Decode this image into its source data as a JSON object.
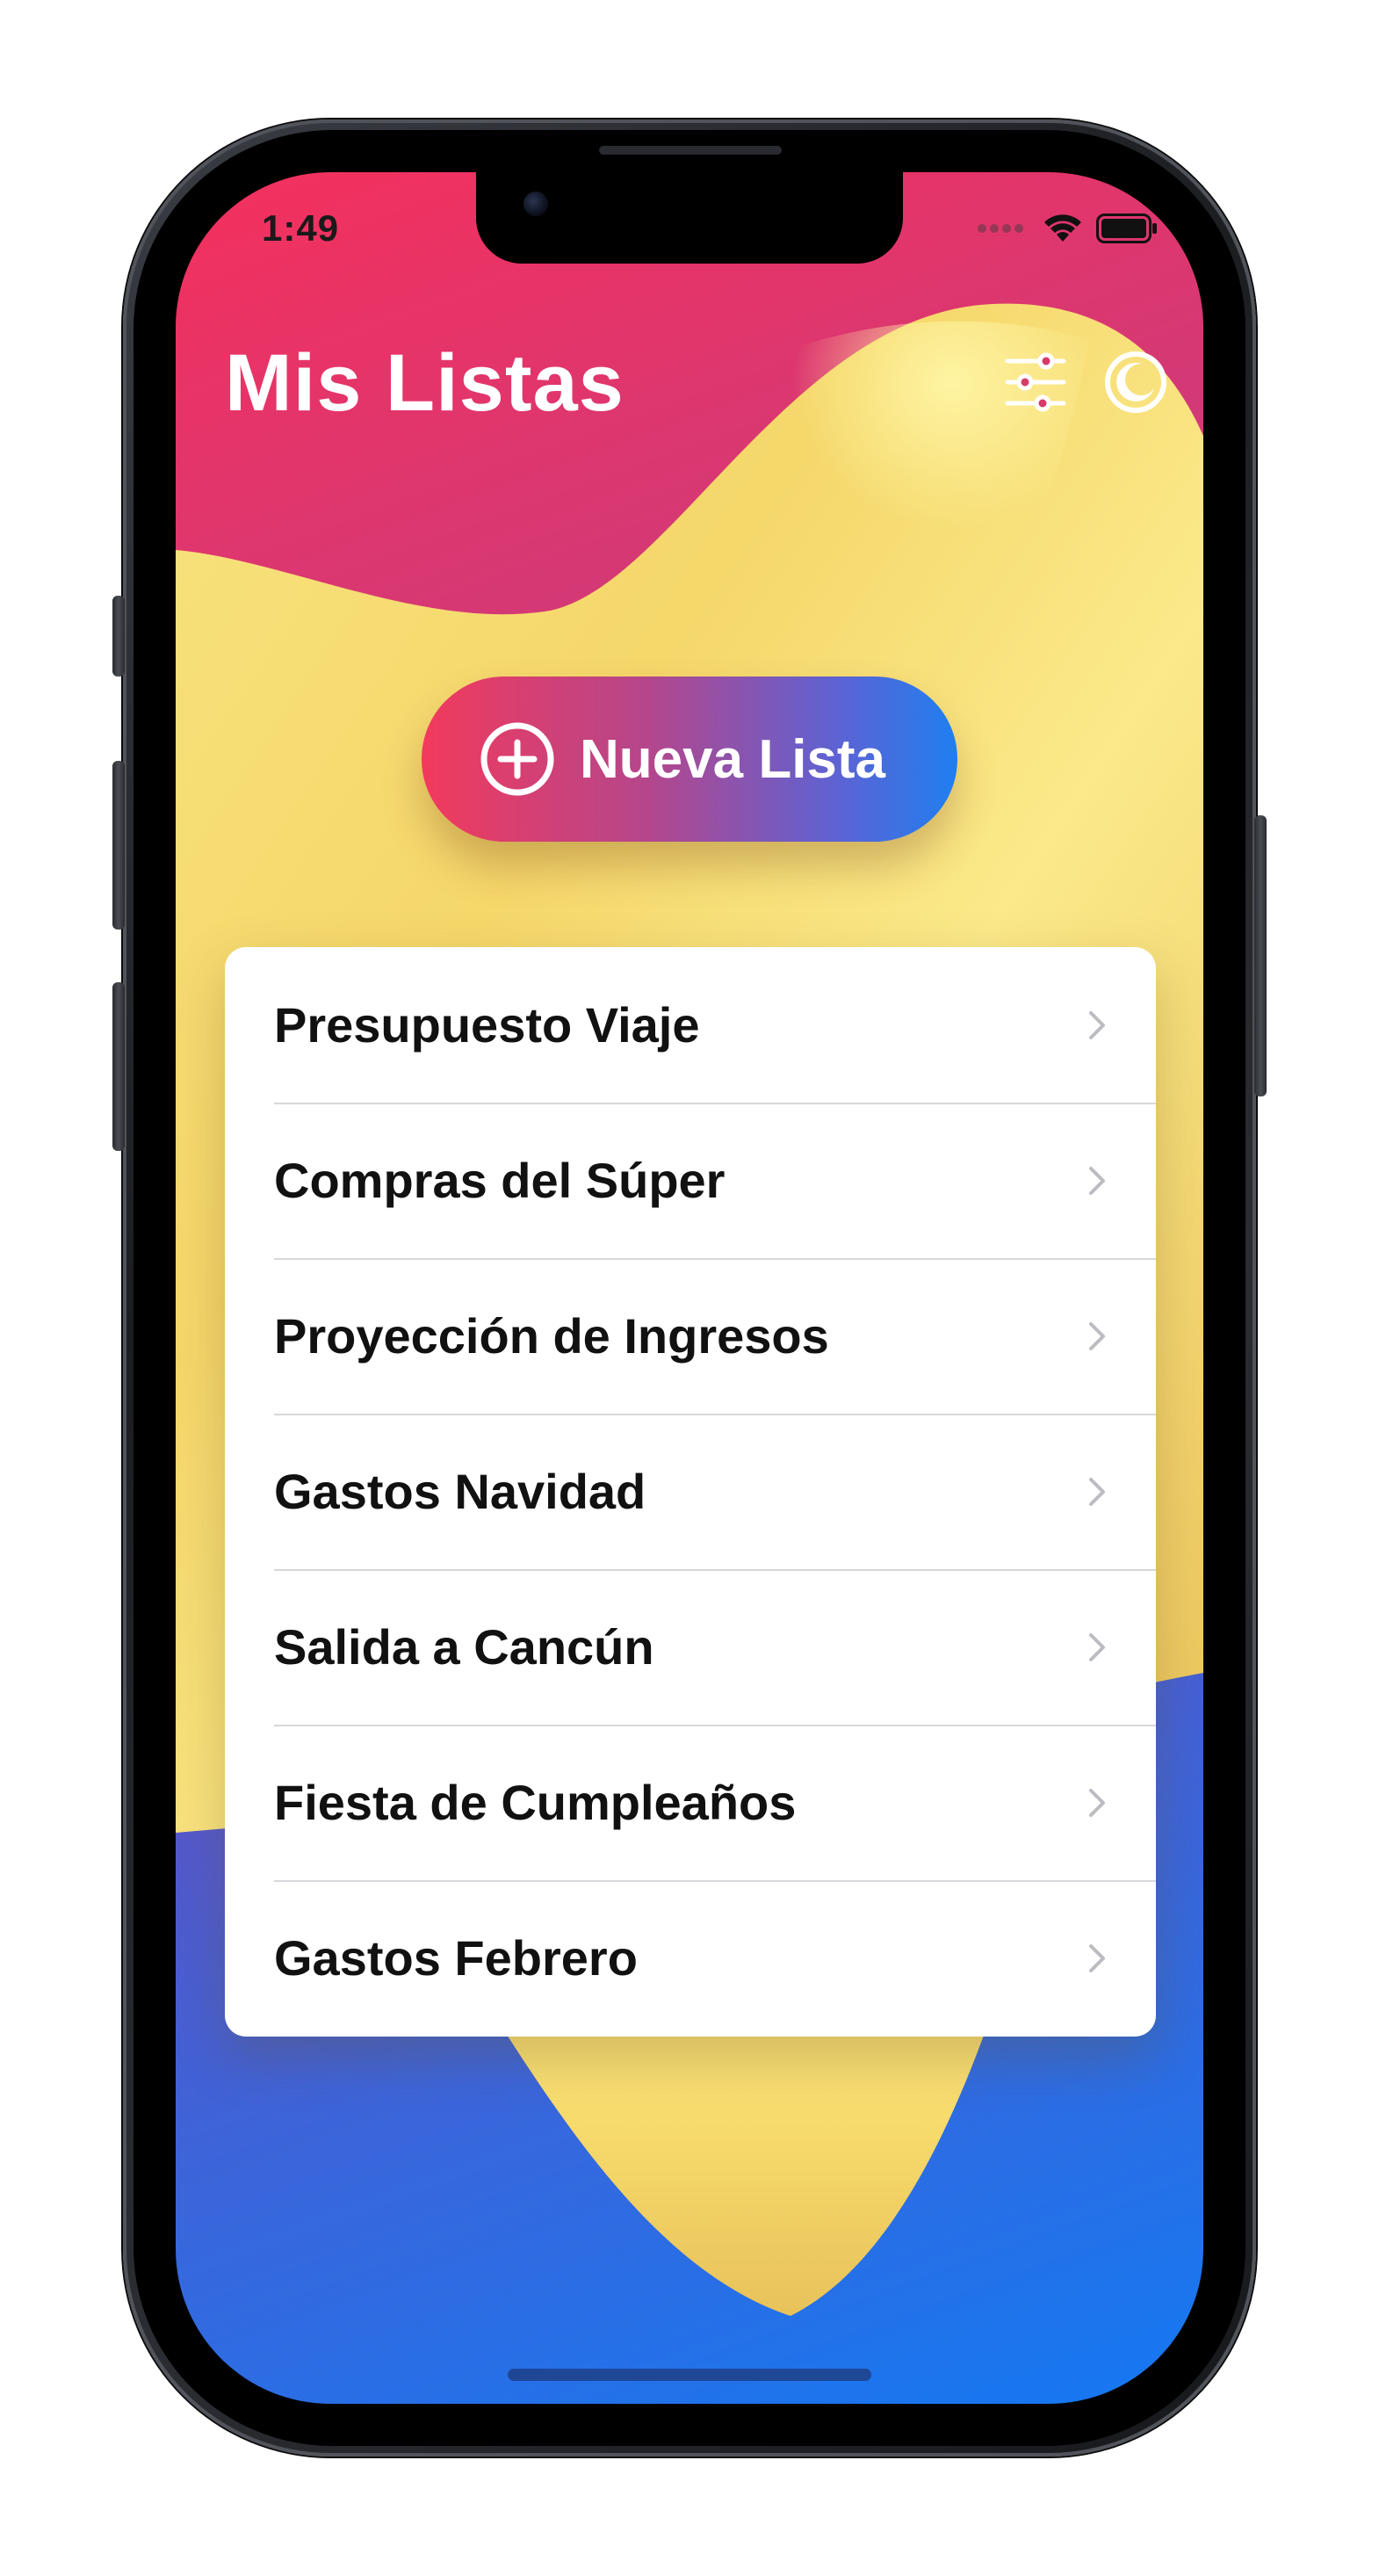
{
  "status_bar": {
    "time": "1:49"
  },
  "header": {
    "title": "Mis Listas",
    "filter_icon": "sliders-icon",
    "theme_icon": "moon-icon"
  },
  "new_list_button": {
    "label": "Nueva Lista",
    "icon": "plus-circle-icon"
  },
  "lists": [
    {
      "label": "Presupuesto Viaje"
    },
    {
      "label": "Compras del Súper"
    },
    {
      "label": "Proyección de Ingresos"
    },
    {
      "label": "Gastos Navidad"
    },
    {
      "label": "Salida a Cancún"
    },
    {
      "label": "Fiesta de Cumpleaños"
    },
    {
      "label": "Gastos Febrero"
    }
  ],
  "colors": {
    "accent_pink": "#f4305d",
    "accent_blue": "#1479f2",
    "wave_yellow": "#f6d86a",
    "card_background": "#ffffff"
  }
}
